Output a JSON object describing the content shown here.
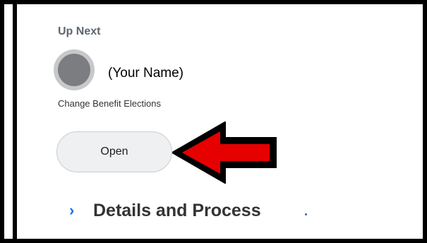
{
  "card": {
    "heading": "Up Next",
    "assignee_name": "(Your Name)",
    "task_title": "Change Benefit Elections",
    "open_label": "Open"
  },
  "section": {
    "title": "Details and Process",
    "chevron_icon": "chevron-right-icon"
  },
  "annotation": {
    "arrow_icon": "left-arrow-icon",
    "arrow_color": "#e60000"
  },
  "colors": {
    "frame": "#000000",
    "accent": "#1a73e8",
    "button_bg": "#eef0f2"
  }
}
